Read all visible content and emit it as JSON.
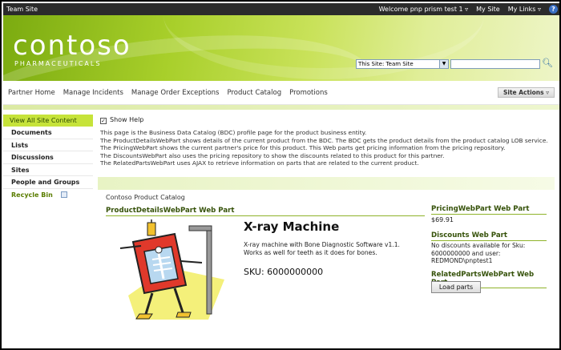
{
  "topbar": {
    "site_name": "Team Site",
    "welcome": "Welcome pnp prism test 1",
    "my_site": "My Site",
    "my_links": "My Links",
    "help_glyph": "?"
  },
  "banner": {
    "logo": "contoso",
    "logo_sub": "PHARMACEUTICALS",
    "search_scope": "This Site: Team Site"
  },
  "nav": {
    "items": [
      "Partner Home",
      "Manage Incidents",
      "Manage Order Exceptions",
      "Product Catalog",
      "Promotions"
    ],
    "site_actions": "Site Actions"
  },
  "sidebar": {
    "view_all": "View All Site Content",
    "items": [
      "Documents",
      "Lists",
      "Discussions",
      "Sites",
      "People and Groups"
    ],
    "recycle_bin": "Recycle Bin"
  },
  "main": {
    "show_help": "Show Help",
    "help_lines": [
      "This page is the Business Data Catalog (BDC) profile page for the product business entity.",
      "The ProductDetailsWebPart shows details of the current product from the BDC. The BDC gets the product details from the product catalog LOB service.",
      "The PricingWebPart shows the current partner's price for this product. This Web parts get pricing information from the pricing repository.",
      "The DiscountsWebPart also uses the pricing repository to show the discounts related to this product for this partner.",
      "The RelatedPartsWebPart uses AJAX to retrieve information on parts that are related to the current product."
    ],
    "catalog_title": "Contoso Product Catalog",
    "product_webpart_title": "ProductDetailsWebPart Web Part",
    "product_name": "X-ray Machine",
    "product_desc": "X-ray machine with Bone Diagnostic Software v1.1. Works as well for teeth as it does for bones.",
    "product_sku": "SKU: 6000000000",
    "pricing_title": "PricingWebPart Web Part",
    "price": "$69.91",
    "discounts_title": "Discounts Web Part",
    "discounts_text": "No discounts available for Sku: 6000000000 and user: REDMOND\\pnptest1",
    "related_title": "RelatedPartsWebPart Web Part",
    "load_parts": "Load parts"
  },
  "colors": {
    "accent_green": "#c6e33a",
    "title_green": "#36520a"
  }
}
